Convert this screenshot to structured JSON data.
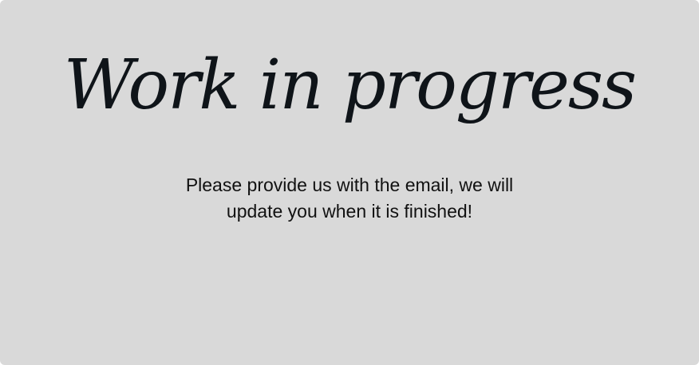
{
  "page": {
    "title": "Work in progress",
    "message_line1": "Please provide us with the email, we will",
    "message_line2": "update you when it is finished!"
  },
  "colors": {
    "background": "#d9d9d9",
    "title_text": "#0f1419",
    "body_text": "#111111"
  }
}
